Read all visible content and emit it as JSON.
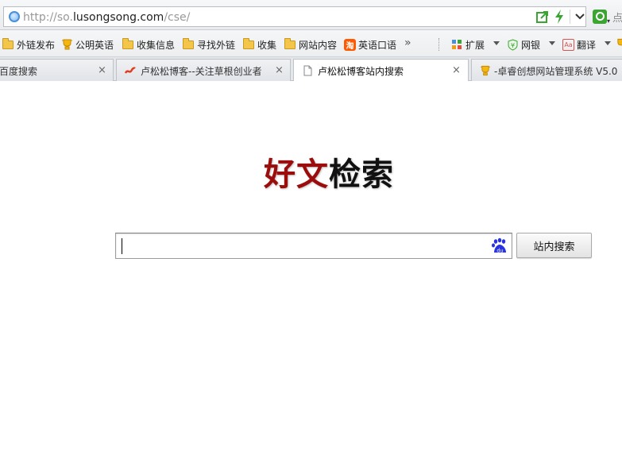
{
  "address_bar": {
    "url_prefix": "http://so.",
    "url_host": "lusongsong.com",
    "url_suffix": "/cse/",
    "search_hint": "点"
  },
  "bookmarks": [
    {
      "label": "外链发布",
      "icon": "folder-icon"
    },
    {
      "label": "公明英语",
      "icon": "trophy-icon"
    },
    {
      "label": "收集信息",
      "icon": "folder-icon"
    },
    {
      "label": "寻找外链",
      "icon": "folder-icon"
    },
    {
      "label": "收集",
      "icon": "folder-icon"
    },
    {
      "label": "网站内容",
      "icon": "folder-icon"
    },
    {
      "label": "英语口语",
      "icon": "taobao-icon",
      "badge": "淘"
    }
  ],
  "extensions": [
    {
      "label": "扩展",
      "icon": "extensions-icon"
    },
    {
      "label": "网银",
      "icon": "bank-icon"
    },
    {
      "label": "翻译",
      "icon": "translate-icon",
      "badge": "Aa"
    }
  ],
  "tabs": [
    {
      "title": "百度搜索",
      "close": "×"
    },
    {
      "title": "卢松松博客--关注草根创业者",
      "close": "×"
    },
    {
      "title": "卢松松博客站内搜索",
      "close": "×",
      "active": true
    },
    {
      "title": "-卓睿创想网站管理系统 V5.0",
      "close": ""
    }
  ],
  "page": {
    "logo_part1": "好文",
    "logo_part2": "检索",
    "search_value": "",
    "search_button": "站内搜索",
    "paw_label": "du"
  },
  "colors": {
    "logo_red": "#9b0d0d",
    "baidu_blue": "#2932e1"
  }
}
